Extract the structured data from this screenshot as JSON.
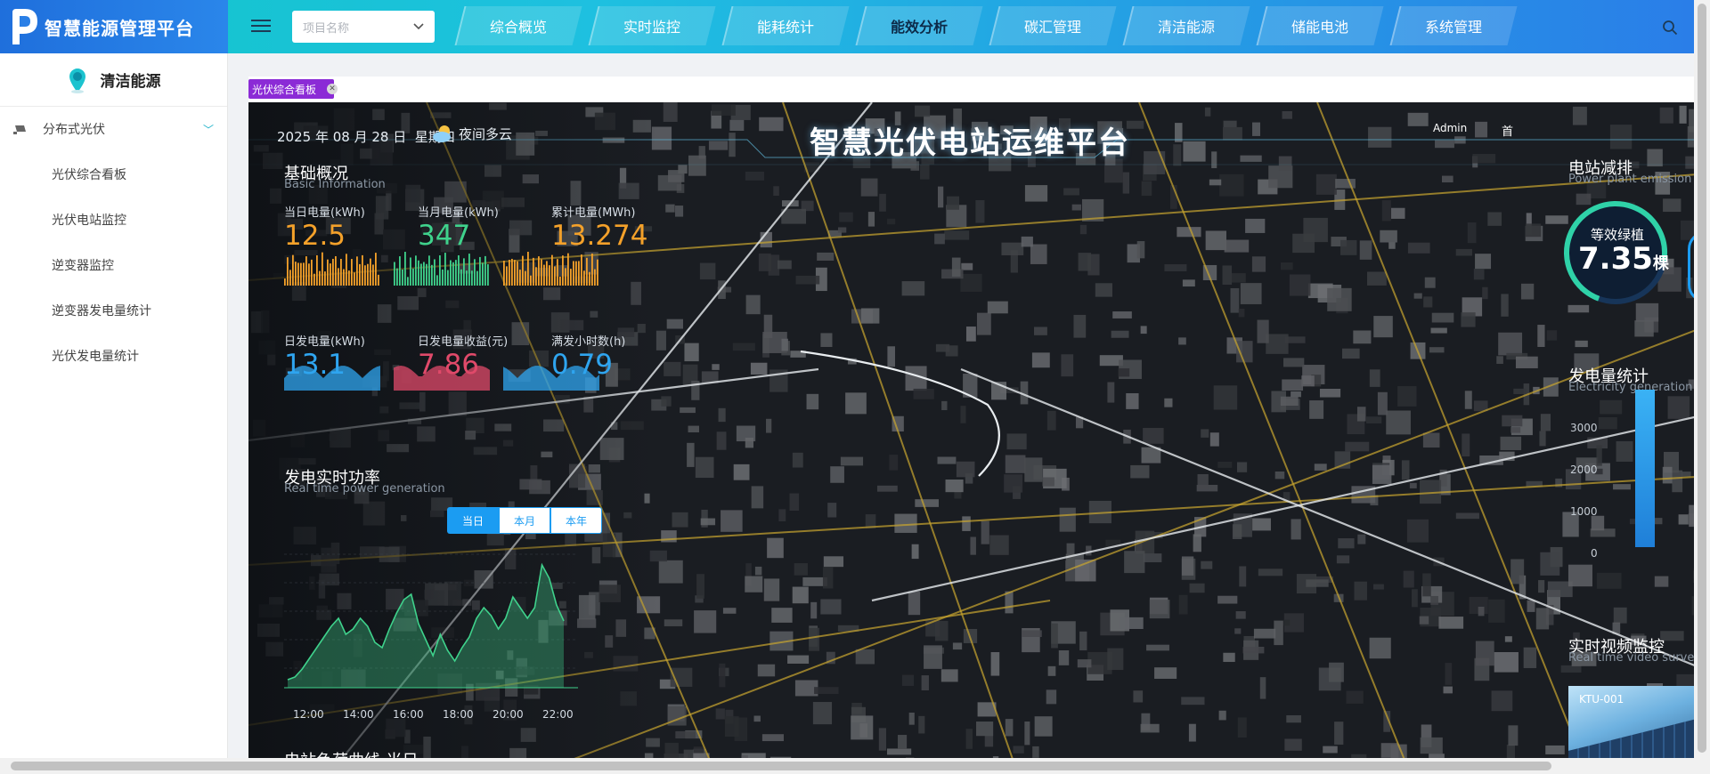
{
  "app": {
    "title": "智慧能源管理平台"
  },
  "header": {
    "project_placeholder": "项目名称",
    "nav": [
      {
        "label": "综合概览",
        "active": false
      },
      {
        "label": "实时监控",
        "active": false
      },
      {
        "label": "能耗统计",
        "active": false
      },
      {
        "label": "能效分析",
        "active": true
      },
      {
        "label": "碳汇管理",
        "active": false
      },
      {
        "label": "清洁能源",
        "active": false
      },
      {
        "label": "储能电池",
        "active": false
      },
      {
        "label": "系统管理",
        "active": false
      }
    ]
  },
  "sidebar": {
    "title": "清洁能源",
    "group": "分布式光伏",
    "items": [
      "光伏综合看板",
      "光伏电站监控",
      "逆变器监控",
      "逆变器发电量统计",
      "光伏发电量统计"
    ]
  },
  "tab": {
    "label": "光伏综合看板"
  },
  "board": {
    "date": "2025 年 08 月 28 日",
    "weekday": "星期四",
    "weather": "夜间多云",
    "title": "智慧光伏电站运维平台",
    "user": "Admin",
    "home": "首",
    "basic": {
      "title": "基础概况",
      "subtitle": "Basic Information"
    },
    "stats": [
      {
        "label": "当日电量(kWh)",
        "value": "12.5",
        "color": "#f4a12a"
      },
      {
        "label": "当月电量(kWh)",
        "value": "347",
        "color": "#3fd28c"
      },
      {
        "label": "累计电量(MWh)",
        "value": "13.274",
        "color": "#f4a12a"
      },
      {
        "label": "日发电量(kWh)",
        "value": "13.1",
        "color": "#2fa5f0"
      },
      {
        "label": "日发电量收益(元)",
        "value": "7.86",
        "color": "#e04a6a"
      },
      {
        "label": "满发小时数(h)",
        "value": "0.79",
        "color": "#2fa5f0"
      }
    ],
    "power": {
      "title": "发电实时功率",
      "subtitle": "Real time power generation",
      "buttons": [
        "当日",
        "本月",
        "本年"
      ]
    },
    "load": {
      "title": "电站负荷曲线-当日"
    },
    "emission": {
      "title": "电站减排",
      "subtitle": "Power plant emission",
      "label": "等效绿植",
      "value": "7.35",
      "unit": "棵",
      "ring_fraction": 0.72
    },
    "generation": {
      "title": "发电量统计",
      "subtitle": "Electricity generation"
    },
    "video": {
      "title": "实时视频监控",
      "subtitle": "Real time video surve",
      "camera": "KTU-001"
    }
  },
  "chart_data": [
    {
      "type": "area",
      "x_ticks": [
        "12:00",
        "14:00",
        "16:00",
        "18:00",
        "20:00",
        "22:00"
      ],
      "values": [
        0.3,
        0.4,
        0.7,
        1.1,
        1.5,
        1.9,
        2.3,
        2.6,
        2.0,
        2.2,
        2.6,
        2.3,
        1.7,
        1.5,
        2.2,
        2.8,
        3.3,
        3.5,
        2.4,
        1.8,
        1.2,
        2.0,
        1.4,
        1.0,
        1.5,
        1.9,
        2.6,
        3.0,
        2.7,
        2.2,
        2.6,
        3.4,
        3.0,
        2.6,
        3.0,
        4.6,
        4.1,
        3.1,
        2.5
      ],
      "color": "#3fd28c"
    },
    {
      "type": "bar",
      "y_ticks": [
        "3000",
        "2000",
        "1000",
        "0"
      ],
      "ylim": [
        0,
        3000
      ],
      "values": [
        3000
      ],
      "color": "#2fa5f0"
    }
  ]
}
